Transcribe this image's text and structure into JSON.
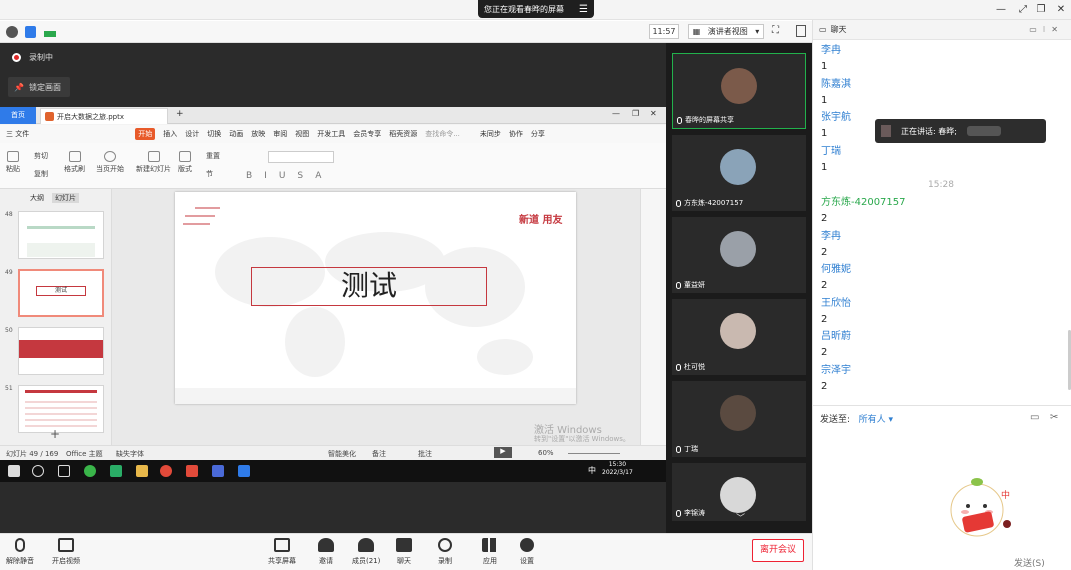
{
  "banner": {
    "watching": "您正在观看春晔的屏幕",
    "menu_icon": "hamburger-icon"
  },
  "meeting_toolbar": {
    "time": "11:57",
    "view_mode": "演讲者视图"
  },
  "share": {
    "recording": "录制中",
    "lock_screen": "锁定画面"
  },
  "wps": {
    "home_tab": "首页",
    "doc_tab": "开启大数据之旅.pptx",
    "menu_file": "三 文件",
    "menu_tabs": [
      "开始",
      "插入",
      "设计",
      "切换",
      "动画",
      "放映",
      "审阅",
      "视图",
      "开发工具",
      "会员专享",
      "稻壳资源"
    ],
    "search": "查找命令...",
    "sync": "未同步",
    "collab": "协作",
    "share": "分享",
    "ribbon": {
      "paste": "粘贴",
      "cut": "剪切",
      "copy": "复制",
      "format_painter": "格式刷",
      "from_current": "当页开始",
      "new_slide": "新建幻灯片",
      "layout": "版式",
      "section": "节",
      "reset": "重置"
    },
    "thumb_tabs": [
      "大纲",
      "幻灯片"
    ],
    "thumb_numbers": [
      "48",
      "49",
      "50",
      "51"
    ],
    "thumb_49_text": "测试",
    "slide_title": "测试",
    "slide_logo": "新道 用友",
    "status": {
      "slide_count": "幻灯片 49 / 169",
      "theme": "Office 主题",
      "font": "缺失字体",
      "smart": "智能美化",
      "notes": "备注",
      "comment": "批注",
      "zoom": "60%"
    }
  },
  "activation": {
    "line1": "激活 Windows",
    "line2": "转到\"设置\"以激活 Windows。"
  },
  "taskbar": {
    "time": "15:30",
    "date": "2022/3/17",
    "ime": "中"
  },
  "videos": [
    {
      "name": "春晔的屏幕共享",
      "active": true,
      "color": "#7b5a4a"
    },
    {
      "name": "方东炼-42007157",
      "active": false,
      "color": "#8aa3b8"
    },
    {
      "name": "董益妍",
      "active": false,
      "color": "#9aa0a8"
    },
    {
      "name": "杜可悦",
      "active": false,
      "color": "#c9b9b0"
    },
    {
      "name": "丁瑞",
      "active": false,
      "color": "#5a4a40"
    },
    {
      "name": "李锦涛",
      "active": false,
      "color": "#d8d8d8"
    }
  ],
  "chat": {
    "title": "聊天",
    "messages": [
      {
        "name": "李冉",
        "body": "1"
      },
      {
        "name": "陈嘉淇",
        "body": "1"
      },
      {
        "name": "张宇航",
        "body": "1"
      },
      {
        "name": "丁瑞",
        "body": "1"
      },
      {
        "time": "15:28"
      },
      {
        "name": "方东炼-42007157",
        "body": "2",
        "green": true
      },
      {
        "name": "李冉",
        "body": "2"
      },
      {
        "name": "何雅妮",
        "body": "2"
      },
      {
        "name": "王欣怡",
        "body": "2"
      },
      {
        "name": "吕昕蔚",
        "body": "2"
      },
      {
        "name": "宗泽宇",
        "body": "2"
      }
    ],
    "send_to_label": "发送至:",
    "send_to_value": "所有人",
    "send_button": "发送(S)"
  },
  "speaking": {
    "label": "正在讲话: 春晔;"
  },
  "bottombar": {
    "mute": "解除静音",
    "video": "开启视频",
    "share": "共享屏幕",
    "invite": "邀请",
    "members": "成员(21)",
    "chat": "聊天",
    "record": "录制",
    "apps": "应用",
    "settings": "设置",
    "leave": "离开会议"
  }
}
